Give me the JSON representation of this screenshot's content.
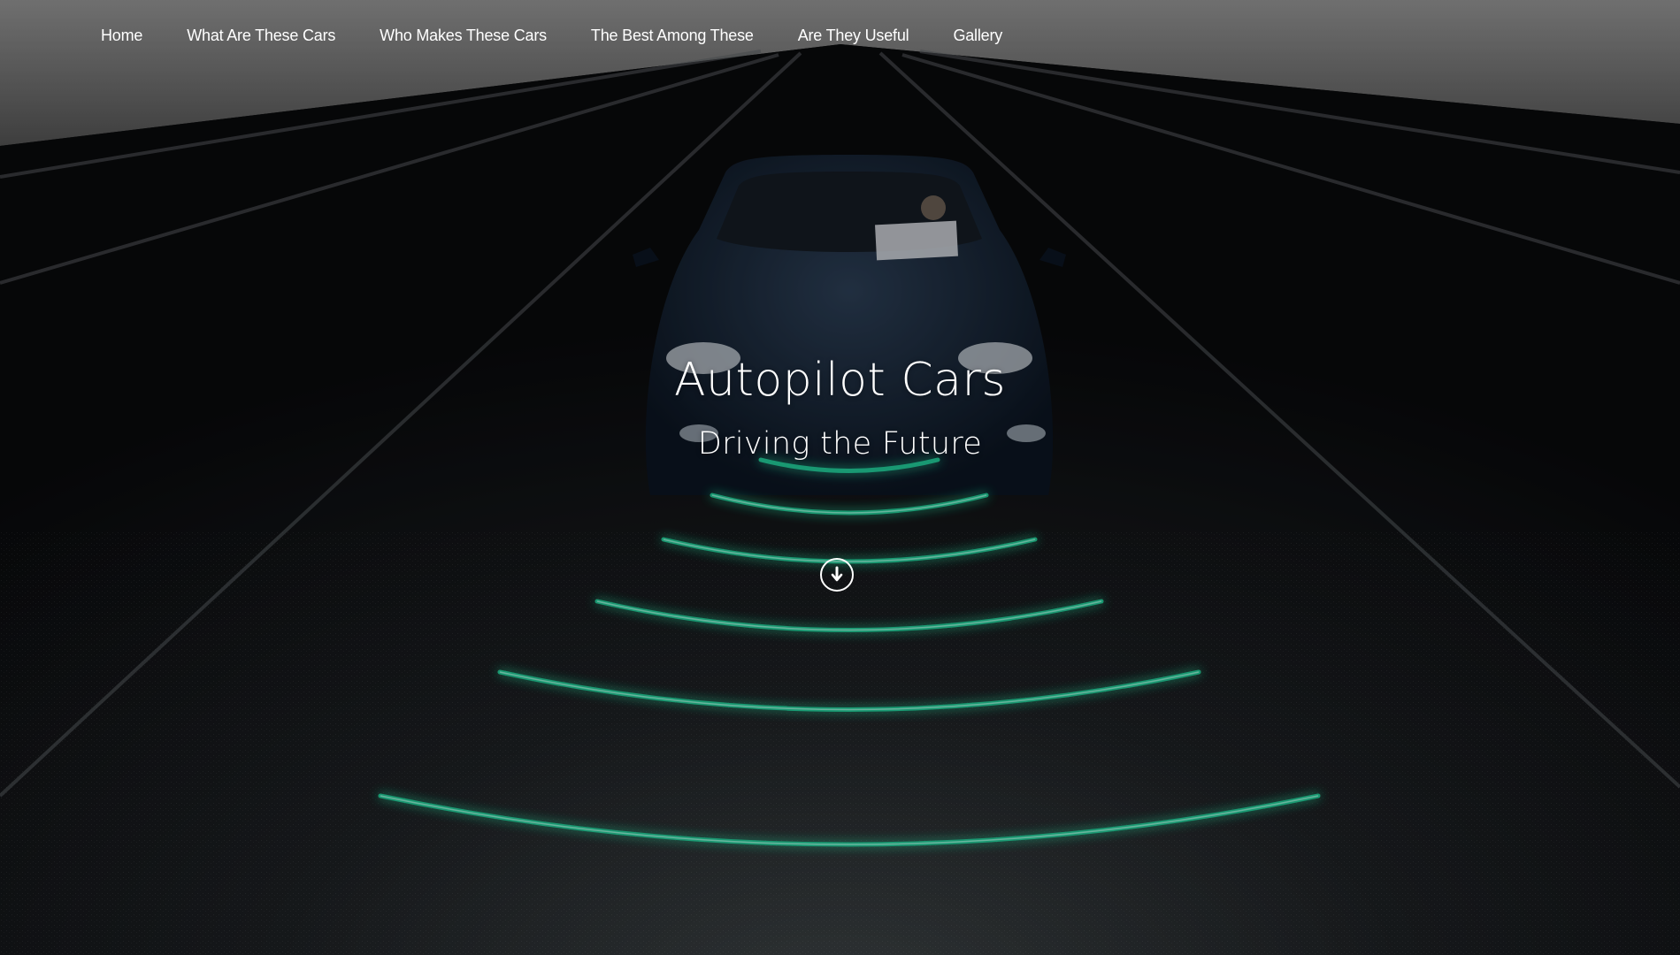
{
  "nav": {
    "items": [
      {
        "label": "Home"
      },
      {
        "label": "What Are These Cars"
      },
      {
        "label": "Who Makes These Cars"
      },
      {
        "label": "The Best Among These"
      },
      {
        "label": "Are They Useful"
      },
      {
        "label": "Gallery"
      }
    ]
  },
  "hero": {
    "title": "Autopilot Cars",
    "subtitle": "Driving the Future",
    "scroll_icon": "arrow-down-circle-icon",
    "image": "self-driving car on dark road with green sensor waves"
  },
  "colors": {
    "sky_top": "#8a8a8a",
    "road": "#0c0d10",
    "sensor_wave": "#1fd29a",
    "text": "#ffffff"
  }
}
